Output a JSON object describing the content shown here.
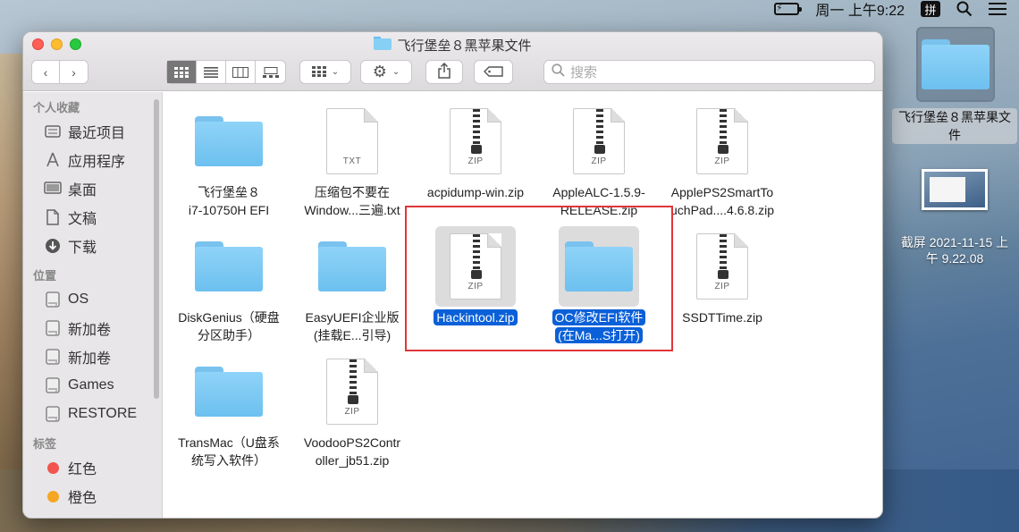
{
  "menubar": {
    "battery_label": "⚡",
    "clock": "周一 上午9:22",
    "ime": "拼",
    "search_icon": "magnifier-icon",
    "list_icon": "list-icon"
  },
  "desktop": {
    "folder_label": "飞行堡垒８黑苹果文件",
    "screenshot_label_line1": "截屏 2021-11-15 上",
    "screenshot_label_line2": "午 9.22.08"
  },
  "window": {
    "title": "飞行堡垒８黑苹果文件",
    "search_placeholder": "搜索",
    "sidebar": {
      "favorites_header": "个人收藏",
      "favorites": [
        {
          "label": "最近项目",
          "icon": "clock-icon"
        },
        {
          "label": "应用程序",
          "icon": "apps-icon"
        },
        {
          "label": "桌面",
          "icon": "desktop-icon"
        },
        {
          "label": "文稿",
          "icon": "document-icon"
        },
        {
          "label": "下载",
          "icon": "download-icon"
        }
      ],
      "locations_header": "位置",
      "locations": [
        {
          "label": "OS",
          "icon": "disk-icon"
        },
        {
          "label": "新加卷",
          "icon": "disk-icon"
        },
        {
          "label": "新加卷",
          "icon": "disk-icon"
        },
        {
          "label": "Games",
          "icon": "disk-icon"
        },
        {
          "label": "RESTORE",
          "icon": "disk-icon"
        }
      ],
      "tags_header": "标签",
      "tags": [
        {
          "label": "红色",
          "color": "#f25450"
        },
        {
          "label": "橙色",
          "color": "#f5a623"
        }
      ]
    },
    "files": [
      {
        "type": "folder",
        "line1": "飞行堡垒８",
        "line2": "i7-10750H EFI",
        "selected": false
      },
      {
        "type": "doc",
        "ext": "TXT",
        "line1": "压缩包不要在",
        "line2": "Window...三遍.txt",
        "selected": false
      },
      {
        "type": "zip",
        "ext": "ZIP",
        "line1": "acpidump-win.zip",
        "line2": "",
        "selected": false
      },
      {
        "type": "zip",
        "ext": "ZIP",
        "line1": "AppleALC-1.5.9-",
        "line2": "RELEASE.zip",
        "selected": false
      },
      {
        "type": "zip",
        "ext": "ZIP",
        "line1": "ApplePS2SmartTo",
        "line2": "uchPad....4.6.8.zip",
        "selected": false
      },
      {
        "type": "folder",
        "line1": "DiskGenius（硬盘",
        "line2": "分区助手）",
        "selected": false
      },
      {
        "type": "folder",
        "line1": "EasyUEFI企业版",
        "line2": "(挂载E...引导)",
        "selected": false
      },
      {
        "type": "zip",
        "ext": "ZIP",
        "line1": "Hackintool.zip",
        "line2": "",
        "selected": true
      },
      {
        "type": "folder",
        "line1": "OC修改EFI软件",
        "line2": "(在Ma...S打开)",
        "selected": true
      },
      {
        "type": "zip",
        "ext": "ZIP",
        "line1": "SSDTTime.zip",
        "line2": "",
        "selected": false
      },
      {
        "type": "folder",
        "line1": "TransMac（U盘系",
        "line2": "统写入软件）",
        "selected": false
      },
      {
        "type": "zip",
        "ext": "ZIP",
        "line1": "VoodooPS2Contr",
        "line2": "oller_jb51.zip",
        "selected": false
      }
    ]
  }
}
